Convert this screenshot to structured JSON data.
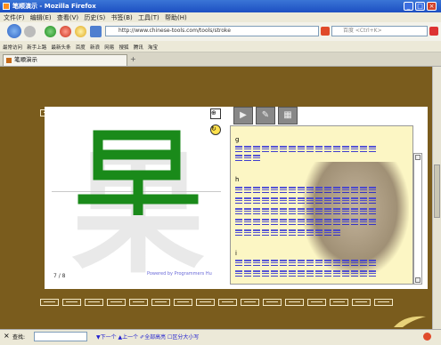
{
  "window": {
    "title": "笔顺演示 - Mozilla Firefox",
    "buttons": {
      "min": "_",
      "max": "□",
      "close": "×"
    }
  },
  "menu": [
    "文件(F)",
    "编辑(E)",
    "查看(V)",
    "历史(S)",
    "书签(B)",
    "工具(T)",
    "帮助(H)"
  ],
  "nav": {
    "address": "http://www.chinese-tools.com/tools/stroke",
    "search_placeholder": "百度 <Ctrl+K>"
  },
  "bookmarks": [
    "最常访问",
    "新手上路",
    "最新头条",
    "百度",
    "新浪",
    "网易",
    "搜狐",
    "腾讯",
    "淘宝"
  ],
  "tab": {
    "label": "笔顺演示",
    "new": "+"
  },
  "stroke_char": {
    "glyph": "果",
    "credit": "Powered by Programmers Hu",
    "counter": "7 / 8"
  },
  "toolbar": {
    "play": "▶",
    "step": "✎",
    "grid": "▦"
  },
  "side_tools": {
    "zoom": "⊕",
    "reset": "↻"
  },
  "list": {
    "sections": [
      {
        "letter": "g"
      },
      {
        "letter": "h"
      },
      {
        "letter": "i"
      }
    ]
  },
  "statusbar": {
    "close": "×",
    "find_label": "查找:",
    "find_text": "▼下一个 ▲上一个 ✐全部高亮 ☐区分大小写"
  }
}
